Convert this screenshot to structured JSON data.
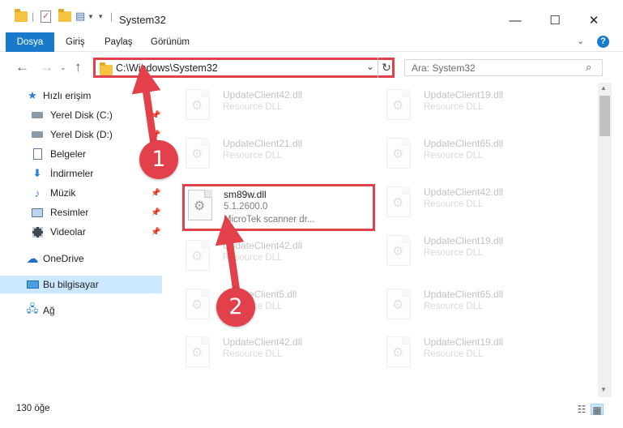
{
  "window": {
    "title": "System32",
    "minimize": "—",
    "maximize": "☐",
    "close": "✕"
  },
  "ribbon": {
    "tabs": [
      "Dosya",
      "Giriş",
      "Paylaş",
      "Görünüm"
    ],
    "help": "?"
  },
  "nav": {
    "address": "C:\\Windows\\System32",
    "search_placeholder": "Ara: System32"
  },
  "sidebar": {
    "quick_access": "Hızlı erişim",
    "items": [
      {
        "label": "Yerel Disk (C:)",
        "icon": "drive-icon"
      },
      {
        "label": "Yerel Disk (D:)",
        "icon": "drive-icon"
      },
      {
        "label": "Belgeler",
        "icon": "documents-icon"
      },
      {
        "label": "İndirmeler",
        "icon": "download-icon"
      },
      {
        "label": "Müzik",
        "icon": "music-icon"
      },
      {
        "label": "Resimler",
        "icon": "pictures-icon"
      },
      {
        "label": "Videolar",
        "icon": "videos-icon"
      }
    ],
    "onedrive": "OneDrive",
    "this_pc": "Bu bilgisayar",
    "network": "Ağ"
  },
  "files": {
    "left": [
      {
        "name": "UpdateClient42.dll",
        "type": "Resource DLL"
      },
      {
        "name": "UpdateClient21.dll",
        "type": "Resource DLL"
      },
      {
        "name": "sm89w.dll",
        "type": "5.1.2600.0",
        "desc": "MicroTek scanner dr..."
      },
      {
        "name": "UpdateClient42.dll",
        "type": "Resource DLL"
      },
      {
        "name": "UpdateClient5.dll",
        "type": "Resource DLL"
      },
      {
        "name": "UpdateClient42.dll",
        "type": "Resource DLL"
      }
    ],
    "right": [
      {
        "name": "UpdateClient19.dll",
        "type": "Resource DLL"
      },
      {
        "name": "UpdateClient65.dll",
        "type": "Resource DLL"
      },
      {
        "name": "UpdateClient42.dll",
        "type": "Resource DLL"
      },
      {
        "name": "UpdateClient19.dll",
        "type": "Resource DLL"
      },
      {
        "name": "UpdateClient65.dll",
        "type": "Resource DLL"
      },
      {
        "name": "UpdateClient19.dll",
        "type": "Resource DLL"
      }
    ]
  },
  "status": {
    "count": "130 öğe"
  },
  "callouts": [
    "1",
    "2"
  ],
  "colors": {
    "accent": "#1979ca",
    "highlight": "#e2404a",
    "selection": "#cce8ff"
  }
}
